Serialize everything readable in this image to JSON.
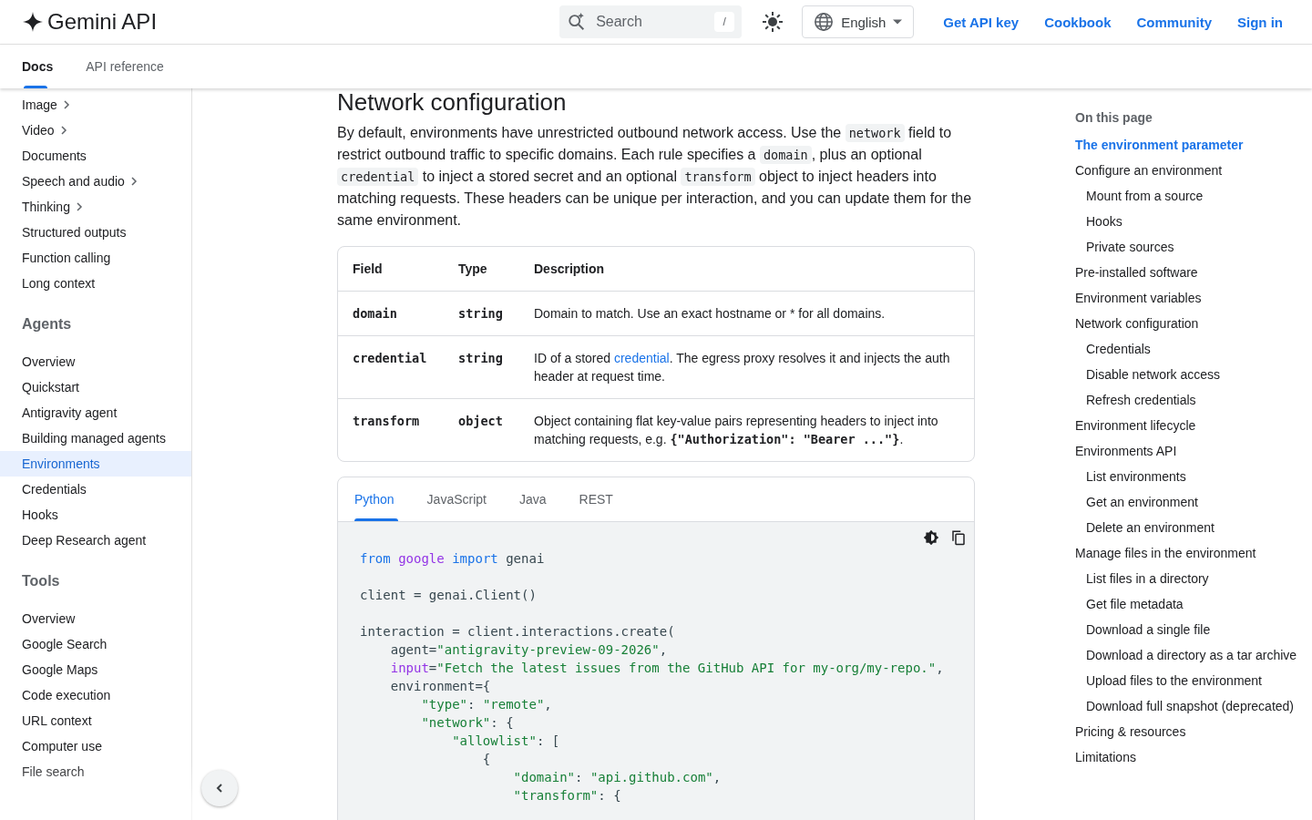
{
  "header": {
    "logo": "Gemini API",
    "search": {
      "placeholder": "Search",
      "shortcut": "/"
    },
    "language": "English",
    "links": [
      "Get API key",
      "Cookbook",
      "Community",
      "Sign in"
    ]
  },
  "subnav": {
    "tabs": [
      {
        "label": "Docs",
        "selected": true
      },
      {
        "label": "API reference",
        "selected": false
      }
    ]
  },
  "sidebar": {
    "sections": [
      {
        "items": [
          {
            "label": "Image",
            "has_children": true,
            "selected": false
          },
          {
            "label": "Video",
            "has_children": true,
            "selected": false
          },
          {
            "label": "Documents",
            "has_children": false,
            "selected": false
          },
          {
            "label": "Speech and audio",
            "has_children": true,
            "selected": false
          },
          {
            "label": "Thinking",
            "has_children": true,
            "selected": false
          },
          {
            "label": "Structured outputs",
            "has_children": false,
            "selected": false
          },
          {
            "label": "Function calling",
            "has_children": false,
            "selected": false
          },
          {
            "label": "Long context",
            "has_children": false,
            "selected": false
          }
        ]
      },
      {
        "heading": "Agents",
        "items": [
          {
            "label": "Overview",
            "has_children": false,
            "selected": false
          },
          {
            "label": "Quickstart",
            "has_children": false,
            "selected": false
          },
          {
            "label": "Antigravity agent",
            "has_children": false,
            "selected": false
          },
          {
            "label": "Building managed agents",
            "has_children": false,
            "selected": false
          },
          {
            "label": "Environments",
            "has_children": false,
            "selected": true
          },
          {
            "label": "Credentials",
            "has_children": false,
            "selected": false
          },
          {
            "label": "Hooks",
            "has_children": false,
            "selected": false
          },
          {
            "label": "Deep Research agent",
            "has_children": false,
            "selected": false
          }
        ]
      },
      {
        "heading": "Tools",
        "items": [
          {
            "label": "Overview",
            "has_children": false,
            "selected": false
          },
          {
            "label": "Google Search",
            "has_children": false,
            "selected": false
          },
          {
            "label": "Google Maps",
            "has_children": false,
            "selected": false
          },
          {
            "label": "Code execution",
            "has_children": false,
            "selected": false
          },
          {
            "label": "URL context",
            "has_children": false,
            "selected": false
          },
          {
            "label": "Computer use",
            "has_children": false,
            "selected": false
          },
          {
            "label": "File search",
            "has_children": false,
            "selected": false
          }
        ]
      }
    ]
  },
  "article": {
    "heading": "Network configuration",
    "intro": [
      {
        "text": "By default, environments have unrestricted outbound network access. Use the ",
        "kind": "text"
      },
      {
        "text": "network",
        "kind": "code"
      },
      {
        "text": " field to restrict outbound traffic to specific domains. Each rule specifies a ",
        "kind": "text"
      },
      {
        "text": "domain",
        "kind": "code"
      },
      {
        "text": ", plus an optional ",
        "kind": "text"
      },
      {
        "text": "credential",
        "kind": "code"
      },
      {
        "text": " to inject a stored secret and an optional ",
        "kind": "text"
      },
      {
        "text": "transform",
        "kind": "code"
      },
      {
        "text": " object to inject headers into matching requests. These headers can be unique per interaction, and you can update them for the same environment.",
        "kind": "text"
      }
    ],
    "table": {
      "columns": [
        "Field",
        "Type",
        "Description"
      ],
      "rows": [
        {
          "field": "domain",
          "type": "string",
          "description": [
            {
              "text": "Domain to match. Use an exact hostname or * for all domains.",
              "kind": "text"
            }
          ]
        },
        {
          "field": "credential",
          "type": "string",
          "description": [
            {
              "text": "ID of a stored ",
              "kind": "text"
            },
            {
              "text": "credential",
              "kind": "link"
            },
            {
              "text": ". The egress proxy resolves it and injects the auth header at request time.",
              "kind": "text"
            }
          ]
        },
        {
          "field": "transform",
          "type": "object",
          "description": [
            {
              "text": "Object containing flat key-value pairs representing headers to inject into matching requests, e.g. ",
              "kind": "text"
            },
            {
              "text": "{\"Authorization\": \"Bearer ...\"}",
              "kind": "code"
            },
            {
              "text": ".",
              "kind": "text"
            }
          ]
        }
      ]
    },
    "code_sample": {
      "tabs": [
        {
          "label": "Python",
          "selected": true
        },
        {
          "label": "JavaScript",
          "selected": false
        },
        {
          "label": "Java",
          "selected": false
        },
        {
          "label": "REST",
          "selected": false
        }
      ],
      "lines": [
        {
          "gap_before": false,
          "tokens": [
            {
              "text": "from",
              "kind": "keyword"
            },
            {
              "text": " google",
              "kind": "module"
            },
            {
              "text": " import",
              "kind": "keyword"
            },
            {
              "text": " genai",
              "kind": "plain"
            }
          ]
        },
        {
          "gap_before": true,
          "tokens": [
            {
              "text": "client = genai.Client()",
              "kind": "plain"
            }
          ]
        },
        {
          "gap_before": true,
          "tokens": [
            {
              "text": "interaction = client.interactions.create(",
              "kind": "plain"
            }
          ]
        },
        {
          "gap_before": false,
          "tokens": [
            {
              "text": "    agent=",
              "kind": "plain"
            },
            {
              "text": "\"antigravity-preview-09-2026\"",
              "kind": "string"
            },
            {
              "text": ",",
              "kind": "plain"
            }
          ]
        },
        {
          "gap_before": false,
          "tokens": [
            {
              "text": "    input",
              "kind": "builtin"
            },
            {
              "text": "=",
              "kind": "plain"
            },
            {
              "text": "\"Fetch the latest issues from the GitHub API for my-org/my-repo.\"",
              "kind": "string"
            },
            {
              "text": ",",
              "kind": "plain"
            }
          ]
        },
        {
          "gap_before": false,
          "tokens": [
            {
              "text": "    environment={",
              "kind": "plain"
            }
          ]
        },
        {
          "gap_before": false,
          "tokens": [
            {
              "text": "        \"type\"",
              "kind": "string"
            },
            {
              "text": ": ",
              "kind": "plain"
            },
            {
              "text": "\"remote\"",
              "kind": "string"
            },
            {
              "text": ",",
              "kind": "plain"
            }
          ]
        },
        {
          "gap_before": false,
          "tokens": [
            {
              "text": "        \"network\"",
              "kind": "string"
            },
            {
              "text": ": {",
              "kind": "plain"
            }
          ]
        },
        {
          "gap_before": false,
          "tokens": [
            {
              "text": "            \"allowlist\"",
              "kind": "string"
            },
            {
              "text": ": [",
              "kind": "plain"
            }
          ]
        },
        {
          "gap_before": false,
          "tokens": [
            {
              "text": "                {",
              "kind": "plain"
            }
          ]
        },
        {
          "gap_before": false,
          "tokens": [
            {
              "text": "                    \"domain\"",
              "kind": "string"
            },
            {
              "text": ": ",
              "kind": "plain"
            },
            {
              "text": "\"api.github.com\"",
              "kind": "string"
            },
            {
              "text": ",",
              "kind": "plain"
            }
          ]
        },
        {
          "gap_before": false,
          "tokens": [
            {
              "text": "                    \"transform\"",
              "kind": "string"
            },
            {
              "text": ": {",
              "kind": "plain"
            }
          ]
        }
      ]
    }
  },
  "toc": {
    "title": "On this page",
    "items": [
      {
        "label": "The environment parameter",
        "selected": true
      },
      {
        "label": "Configure an environment",
        "selected": false,
        "children": [
          {
            "label": "Mount from a source",
            "selected": false
          },
          {
            "label": "Hooks",
            "selected": false
          },
          {
            "label": "Private sources",
            "selected": false
          }
        ]
      },
      {
        "label": "Pre-installed software",
        "selected": false
      },
      {
        "label": "Environment variables",
        "selected": false
      },
      {
        "label": "Network configuration",
        "selected": false,
        "children": [
          {
            "label": "Credentials",
            "selected": false
          },
          {
            "label": "Disable network access",
            "selected": false
          },
          {
            "label": "Refresh credentials",
            "selected": false
          }
        ]
      },
      {
        "label": "Environment lifecycle",
        "selected": false
      },
      {
        "label": "Environments API",
        "selected": false,
        "children": [
          {
            "label": "List environments",
            "selected": false
          },
          {
            "label": "Get an environment",
            "selected": false
          },
          {
            "label": "Delete an environment",
            "selected": false
          }
        ]
      },
      {
        "label": "Manage files in the environment",
        "selected": false,
        "children": [
          {
            "label": "List files in a directory",
            "selected": false
          },
          {
            "label": "Get file metadata",
            "selected": false
          },
          {
            "label": "Download a single file",
            "selected": false
          },
          {
            "label": "Download a directory as a tar archive",
            "selected": false
          },
          {
            "label": "Upload files to the environment",
            "selected": false
          },
          {
            "label": "Download full snapshot (deprecated)",
            "selected": false
          }
        ]
      },
      {
        "label": "Pricing & resources",
        "selected": false
      },
      {
        "label": "Limitations",
        "selected": false
      }
    ]
  }
}
